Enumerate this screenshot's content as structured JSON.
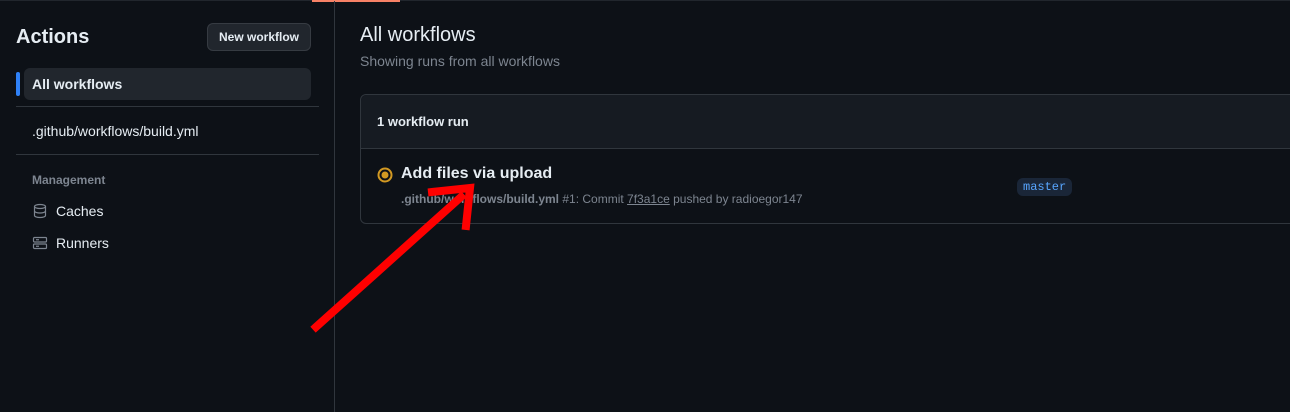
{
  "sidebar": {
    "title": "Actions",
    "new_workflow_label": "New workflow",
    "all_workflows_label": "All workflows",
    "workflow_item_label": ".github/workflows/build.yml",
    "management_heading": "Management",
    "caches_label": "Caches",
    "runners_label": "Runners"
  },
  "main": {
    "title": "All workflows",
    "subtitle": "Showing runs from all workflows",
    "runs_count_label": "1 workflow run",
    "run": {
      "title": "Add files via upload",
      "workflow_file": ".github/workflows/build.yml",
      "run_number": "#1: Commit",
      "commit": "7f3a1ce",
      "pushed_by": "pushed by radioegor147",
      "branch": "master",
      "status": "in-progress"
    }
  },
  "colors": {
    "background": "#0d1117",
    "accent_blue": "#2f81f7",
    "status_yellow": "#d29922",
    "annotation_red": "#ff0000"
  },
  "icons": {
    "caches": "database-icon",
    "runners": "server-icon",
    "status": "in-progress-icon"
  }
}
